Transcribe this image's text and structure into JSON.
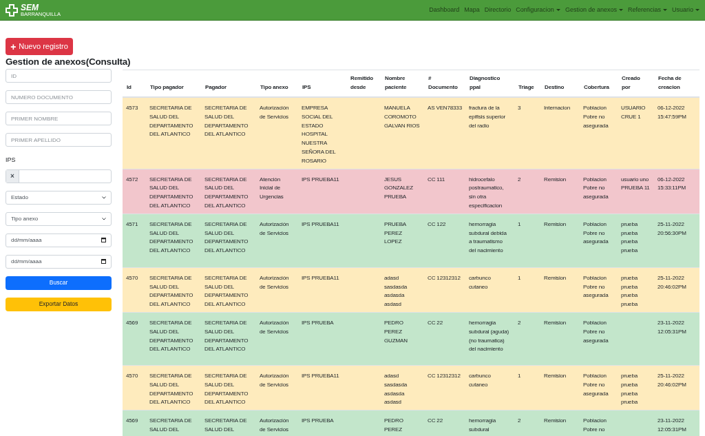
{
  "navbar": {
    "logo": "SEM",
    "logo_sub": "BARRANQUILLA",
    "items": [
      {
        "label": "Dashboard",
        "dropdown": false
      },
      {
        "label": "Mapa",
        "dropdown": false
      },
      {
        "label": "Directorio",
        "dropdown": false
      },
      {
        "label": "Configuracion",
        "dropdown": true
      },
      {
        "label": "Gestion de anexos",
        "dropdown": true
      },
      {
        "label": "Referencias",
        "dropdown": true
      },
      {
        "label": "Usuario",
        "dropdown": true
      }
    ]
  },
  "new_button": {
    "icon": "+",
    "label": "Nuevo registro"
  },
  "title": "Gestion de anexos(Consulta)",
  "filters": [
    {
      "kind": "text",
      "placeholder": "ID"
    },
    {
      "kind": "text",
      "placeholder": "NUMERO DOCUMENTO"
    },
    {
      "kind": "text",
      "placeholder": "PRIMER NOMBRE"
    },
    {
      "kind": "text",
      "placeholder": "PRIMER APELLIDO"
    },
    {
      "kind": "label",
      "label": "IPS"
    },
    {
      "kind": "clearable",
      "clear": "×"
    },
    {
      "kind": "select",
      "value": "Estado"
    },
    {
      "kind": "select",
      "value": "Tipo anexo"
    },
    {
      "kind": "date",
      "value": "dd/mm/aaaa"
    },
    {
      "kind": "date",
      "value": "dd/mm/aaaa"
    }
  ],
  "search_button": "Buscar",
  "export_button": "Exportar Datos",
  "table": {
    "columns": [
      "Id",
      "Tipo pagador",
      "Pagador",
      "Tipo anexo",
      "IPS",
      "Remitido desde",
      "Nombre paciente",
      "# Documento",
      "Diagnostico ppal",
      "Triage",
      "Destino",
      "Cobertura",
      "Creado por",
      "Fecha de creacion"
    ],
    "rows": [
      {
        "color": "#feebbd",
        "cells": [
          "4573",
          "SECRETARIA DE SALUD DEL DEPARTAMENTO DEL ATLANTICO",
          "SECRETARIA DE SALUD DEL DEPARTAMENTO DEL ATLANTICO",
          "Autorización de Servicios",
          "EMPRESA SOCIAL DEL ESTADO HOSPITAL NUESTRA SEÑORA DEL ROSARIO",
          "",
          "MANUELA COROMOTO GALVAN RIOS",
          "AS VEN78333",
          "fractura de la epifisis superior del radio",
          "3",
          "Internacion",
          "Poblacion Pobre no asegurada",
          "USUARIO CRUE 1",
          "06-12-2022 15:47:59PM"
        ]
      },
      {
        "color": "#f2c6cc",
        "cells": [
          "4572",
          "SECRETARIA DE SALUD DEL DEPARTAMENTO DEL ATLANTICO",
          "SECRETARIA DE SALUD DEL DEPARTAMENTO DEL ATLANTICO",
          "Atención Inicial de Urgencias",
          "IPS PRUEBA11",
          "",
          "JESUS GONZALEZ PRUEBA",
          "CC 111",
          "hidrocefalo postraumatico, sin otra especificacion",
          "2",
          "Remision",
          "Poblacion Pobre no asegurada",
          "usuario uno PRUEBA 11",
          "06-12-2022 15:33:11PM"
        ]
      },
      {
        "color": "#c3e6cb",
        "cells": [
          "4571",
          "SECRETARIA DE SALUD DEL DEPARTAMENTO DEL ATLANTICO",
          "SECRETARIA DE SALUD DEL DEPARTAMENTO DEL ATLANTICO",
          "Autorización de Servicios",
          "IPS PRUEBA11",
          "",
          "PRUEBA PEREZ LOPEZ",
          "CC 122",
          "hemorragia subdural debida a traumatismo del nacimiento",
          "1",
          "Remision",
          "Poblacion Pobre no asegurada",
          "prueba prueba prueba prueba",
          "25-11-2022 20:56:30PM"
        ]
      },
      {
        "color": "#feebbd",
        "cells": [
          "4570",
          "SECRETARIA DE SALUD DEL DEPARTAMENTO DEL ATLANTICO",
          "SECRETARIA DE SALUD DEL DEPARTAMENTO DEL ATLANTICO",
          "Autorización de Servicios",
          "IPS PRUEBA11",
          "",
          "adasd sasdasda asdasda asdasd",
          "CC 12312312",
          "carbunco cutaneo",
          "1",
          "Remision",
          "Poblacion Pobre no asegurada",
          "prueba prueba prueba prueba",
          "25-11-2022 20:46:02PM"
        ]
      },
      {
        "color": "#c3e6cb",
        "cells": [
          "4569",
          "SECRETARIA DE SALUD DEL DEPARTAMENTO DEL ATLANTICO",
          "SECRETARIA DE SALUD DEL DEPARTAMENTO DEL ATLANTICO",
          "Autorización de Servicios",
          "IPS PRUEBA",
          "",
          "PEDRO PEREZ GUZMAN",
          "CC 22",
          "hemorragia subdural (aguda) (no traumatica) del nacimiento",
          "2",
          "Remision",
          "Poblacion Pobre no asegurada",
          "",
          "23-11-2022 12:05:31PM"
        ]
      },
      {
        "color": "#feebbd",
        "cells": [
          "4570",
          "SECRETARIA DE SALUD DEL DEPARTAMENTO DEL ATLANTICO",
          "SECRETARIA DE SALUD DEL DEPARTAMENTO DEL ATLANTICO",
          "Autorización de Servicios",
          "IPS PRUEBA11",
          "",
          "adasd sasdasda asdasda asdasd",
          "CC 12312312",
          "carbunco cutaneo",
          "1",
          "Remision",
          "Poblacion Pobre no asegurada",
          "prueba prueba prueba prueba",
          "25-11-2022 20:46:02PM"
        ]
      },
      {
        "color": "#c3e6cb",
        "cells": [
          "4569",
          "SECRETARIA DE SALUD DEL",
          "SECRETARIA DE SALUD DEL",
          "Autorización de Servicios",
          "IPS PRUEBA",
          "",
          "PEDRO PEREZ",
          "CC 22",
          "hemorragia subdural",
          "2",
          "Remision",
          "Poblacion Pobre no",
          "",
          "23-11-2022 12:05:31PM"
        ]
      }
    ]
  }
}
